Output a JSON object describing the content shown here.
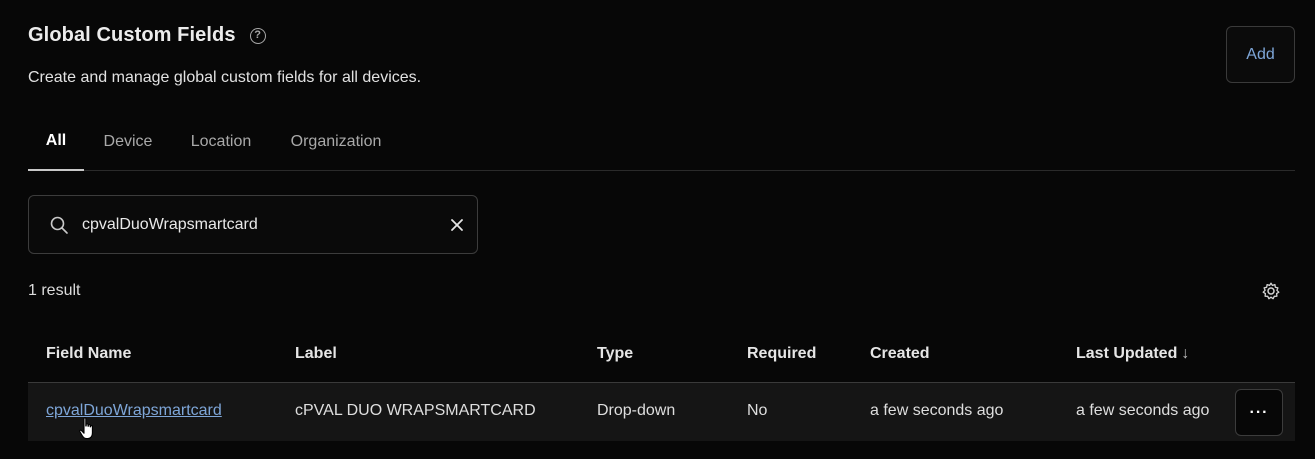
{
  "header": {
    "title": "Global Custom Fields",
    "help_icon": "question-circle-icon",
    "subtitle": "Create and manage global custom fields for all devices.",
    "add_label": "Add"
  },
  "tabs": [
    {
      "label": "All",
      "active": true
    },
    {
      "label": "Device",
      "active": false
    },
    {
      "label": "Location",
      "active": false
    },
    {
      "label": "Organization",
      "active": false
    }
  ],
  "search": {
    "value": "cpvalDuoWrapsmartcard",
    "icon": "search-icon",
    "clear_icon": "close-icon"
  },
  "results": {
    "count_text": "1 result",
    "settings_icon": "gear-icon"
  },
  "table": {
    "columns": [
      "Field Name",
      "Label",
      "Type",
      "Required",
      "Created",
      "Last Updated"
    ],
    "sort_indicator": "↓",
    "rows": [
      {
        "field_name": "cpvalDuoWrapsmartcard",
        "label": "cPVAL DUO WRAPSMARTCARD",
        "type": "Drop-down",
        "required": "No",
        "created": "a few seconds ago",
        "last_updated": "a few seconds ago",
        "menu_label": "···"
      }
    ]
  },
  "colors": {
    "background": "#070707",
    "link": "#7ea6d8",
    "border": "#3a3a3a",
    "row_background": "#151515"
  }
}
